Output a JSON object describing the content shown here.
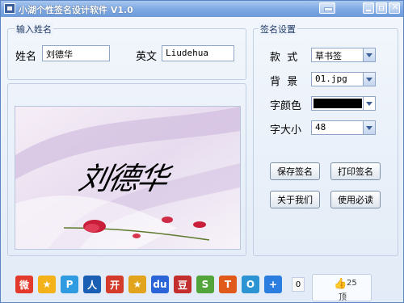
{
  "window": {
    "title": "小湖个性签名设计软件 V1.0"
  },
  "name_group": {
    "legend": "输入姓名",
    "chinese_label": "姓名",
    "chinese_value": "刘德华",
    "english_label": "英文",
    "english_value": "Liudehua"
  },
  "settings_group": {
    "legend": "签名设置",
    "style_label": "款  式",
    "style_value": "草书签",
    "background_label": "背  景",
    "background_value": "01.jpg",
    "color_label": "字颜色",
    "color_value": "#000000",
    "size_label": "字大小",
    "size_value": "48"
  },
  "buttons": {
    "save": "保存签名",
    "print": "打印签名",
    "about": "关于我们",
    "must_read": "使用必读"
  },
  "preview": {
    "signature_text": "刘德华"
  },
  "social": {
    "icons": [
      {
        "name": "weibo-icon",
        "color": "#e33a2e",
        "glyph": "微"
      },
      {
        "name": "qzone-icon",
        "color": "#f3b11a",
        "glyph": "★"
      },
      {
        "name": "tencent-weibo-icon",
        "color": "#2f9be0",
        "glyph": "P"
      },
      {
        "name": "renren-icon",
        "color": "#1a5fb4",
        "glyph": "人"
      },
      {
        "name": "kaixin-icon",
        "color": "#d33b2a",
        "glyph": "开"
      },
      {
        "name": "pengyou-icon",
        "color": "#e2a41d",
        "glyph": "★"
      },
      {
        "name": "baidu-icon",
        "color": "#2b64d6",
        "glyph": "du"
      },
      {
        "name": "douban-icon",
        "color": "#c32f2f",
        "glyph": "豆"
      },
      {
        "name": "sohu-icon",
        "color": "#53a43a",
        "glyph": "S"
      },
      {
        "name": "tianya-icon",
        "color": "#e05a1c",
        "glyph": "T"
      },
      {
        "name": "360-icon",
        "color": "#2c94d3",
        "glyph": "O"
      },
      {
        "name": "more-share-icon",
        "color": "#2c7de0",
        "glyph": "+"
      }
    ],
    "share_count": "0",
    "like_count": "25",
    "like_label": "顶"
  }
}
